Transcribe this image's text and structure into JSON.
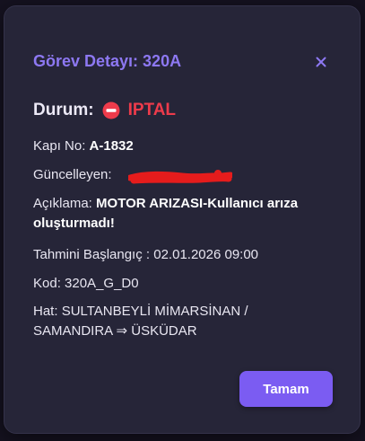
{
  "modal": {
    "title": "Görev Detayı: 320A",
    "close_icon": "close-icon",
    "status": {
      "label": "Durum:",
      "icon": "no-entry-icon",
      "value": "IPTAL",
      "color": "#ee3b4b"
    },
    "fields": {
      "door_label": "Kapı No:",
      "door_value": "A-1832",
      "updated_by_label": "Güncelleyen:",
      "description_label": "Açıklama:",
      "description_value": "MOTOR ARIZASI-Kullanıcı arıza oluşturmadı!",
      "estimated_start_label": "Tahmini Başlangıç :",
      "estimated_start_value": "02.01.2026 09:00",
      "code_label": "Kod:",
      "code_value": "320A_G_D0",
      "line_label": "Hat:",
      "line_value": "SULTANBEYLİ MİMARSİNAN / SAMANDIRA ⇒ ÜSKÜDAR"
    },
    "ok_button": "Tamam",
    "accent_color": "#8d78f2",
    "button_color": "#7b5cf2"
  }
}
